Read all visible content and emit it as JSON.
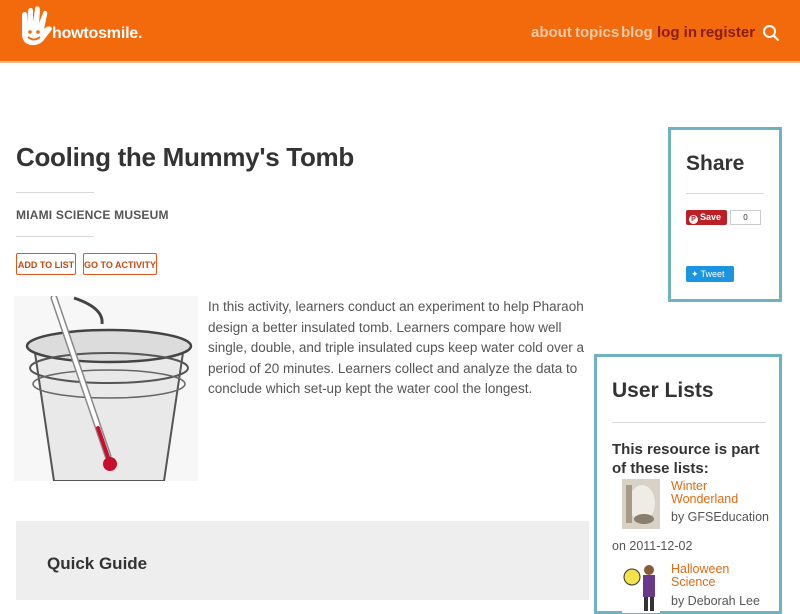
{
  "header": {
    "logo_text": "howtosmile.",
    "nav": [
      {
        "label": "about"
      },
      {
        "label": "topics"
      },
      {
        "label": "blog"
      },
      {
        "label": "log in"
      },
      {
        "label": "register"
      }
    ],
    "search_icon": "search-icon"
  },
  "resource": {
    "title": "Cooling the Mummy's Tomb",
    "provider": "MIAMI SCIENCE MUSEUM",
    "add_to_list": "ADD TO LIST",
    "go_to_activity": "GO TO ACTIVITY",
    "description": "In this activity, learners conduct an experiment to help Pharaoh design a better insulated tomb. Learners compare how well single, double, and triple insulated cups keep water cold over a period of 20 minutes. Learners collect and analyze the data to conclude which set-up kept the water cool the longest.",
    "quick_guide_title": "Quick Guide"
  },
  "share": {
    "title": "Share",
    "pinterest_label": "Save",
    "pinterest_count": "0",
    "tweet_label": "Tweet"
  },
  "user_lists": {
    "title": "User Lists",
    "subtitle": "This resource is part of these lists:",
    "items": [
      {
        "name": "Winter Wonderland",
        "by": "by GFSEducation",
        "date": "on 2011-12-02"
      },
      {
        "name": "Halloween Science",
        "by": "by Deborah Lee"
      }
    ]
  },
  "colors": {
    "brand_orange": "#f26a0c",
    "accent_teal": "#6fb2c2",
    "link_orange": "#e36a12"
  }
}
